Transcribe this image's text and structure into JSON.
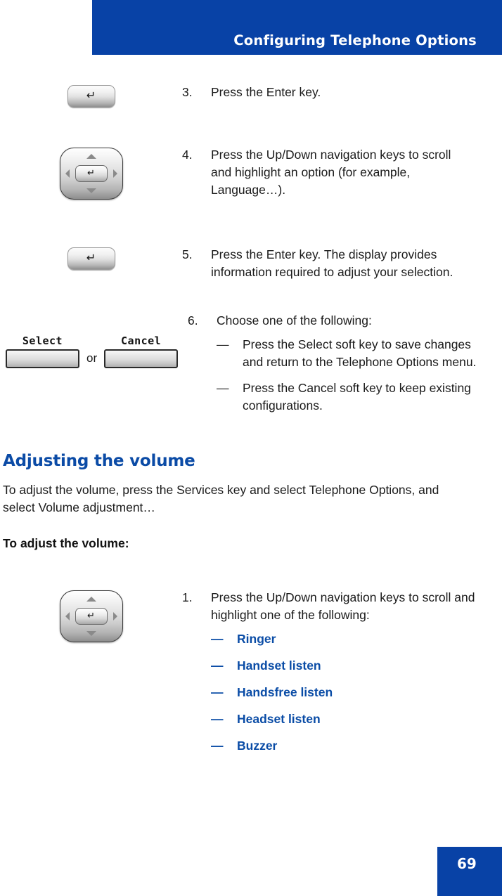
{
  "header": {
    "title": "Configuring Telephone Options",
    "band_color": "#0842a6",
    "text_color": "#ffffff"
  },
  "accent_color": "#0a4ca6",
  "steps": [
    {
      "number": "3.",
      "icon": "enter-key",
      "text_parts": [
        {
          "t": "Press the ",
          "style": "plain"
        },
        {
          "t": "Enter",
          "style": "blue-bold"
        },
        {
          "t": " key.",
          "style": "plain"
        }
      ]
    },
    {
      "number": "4.",
      "icon": "navigation-cluster",
      "text_parts": [
        {
          "t": "Press the ",
          "style": "plain"
        },
        {
          "t": "Up/Down",
          "style": "blue-bold"
        },
        {
          "t": " navigation keys to scroll and highlight an option (for example, ",
          "style": "plain"
        },
        {
          "t": "Language…",
          "style": "blue-bold"
        },
        {
          "t": ").",
          "style": "plain"
        }
      ]
    },
    {
      "number": "5.",
      "icon": "enter-key",
      "text_parts": [
        {
          "t": "Press the ",
          "style": "plain"
        },
        {
          "t": "Enter",
          "style": "blue-bold"
        },
        {
          "t": " key. The display provides information required to adjust your selection.",
          "style": "plain"
        }
      ]
    },
    {
      "number": "6.",
      "icon": "soft-keys",
      "text_parts": [
        {
          "t": "Choose one of the following:",
          "style": "plain"
        }
      ],
      "sub_items": [
        {
          "dash": "—",
          "parts": [
            {
              "t": "Press the ",
              "style": "plain"
            },
            {
              "t": "Select",
              "style": "blue-bold"
            },
            {
              "t": " soft key to save changes and return to the ",
              "style": "plain"
            },
            {
              "t": "Telephone Options",
              "style": "blue-bold"
            },
            {
              "t": " menu.",
              "style": "plain"
            }
          ]
        },
        {
          "dash": "—",
          "parts": [
            {
              "t": "Press the ",
              "style": "plain"
            },
            {
              "t": "Cancel",
              "style": "blue-bold"
            },
            {
              "t": " soft key to keep existing configurations.",
              "style": "plain"
            }
          ]
        }
      ]
    }
  ],
  "softkeys": {
    "select_label": "Select",
    "or_label": "or",
    "cancel_label": "Cancel"
  },
  "section": {
    "heading": "Adjusting the volume",
    "paragraph_parts": [
      {
        "t": "To adjust the volume, press the ",
        "style": "plain"
      },
      {
        "t": "Services",
        "style": "blue-bold"
      },
      {
        "t": " key and select ",
        "style": "plain"
      },
      {
        "t": "Telephone Options",
        "style": "blue-bold"
      },
      {
        "t": ", and select ",
        "style": "plain"
      },
      {
        "t": "Volume adjustment…",
        "style": "blue-bold"
      }
    ],
    "subheading": "To adjust the volume:"
  },
  "volume_step": {
    "number": "1.",
    "icon": "navigation-cluster",
    "text_parts": [
      {
        "t": "Press the ",
        "style": "plain"
      },
      {
        "t": "Up/Down",
        "style": "blue-bold"
      },
      {
        "t": " navigation keys to scroll and highlight one of the following:",
        "style": "plain"
      }
    ],
    "options": [
      {
        "dash": "—",
        "label": "Ringer"
      },
      {
        "dash": "—",
        "label": "Handset listen"
      },
      {
        "dash": "—",
        "label": "Handsfree listen"
      },
      {
        "dash": "—",
        "label": "Headset listen"
      },
      {
        "dash": "—",
        "label": "Buzzer"
      }
    ]
  },
  "footer": {
    "page_number": "69",
    "box_color": "#0842a6"
  },
  "icons": {
    "enter_glyph": "↵",
    "nav_up": "up-triangle",
    "nav_down": "down-triangle",
    "nav_left": "left-triangle",
    "nav_right": "right-triangle"
  }
}
